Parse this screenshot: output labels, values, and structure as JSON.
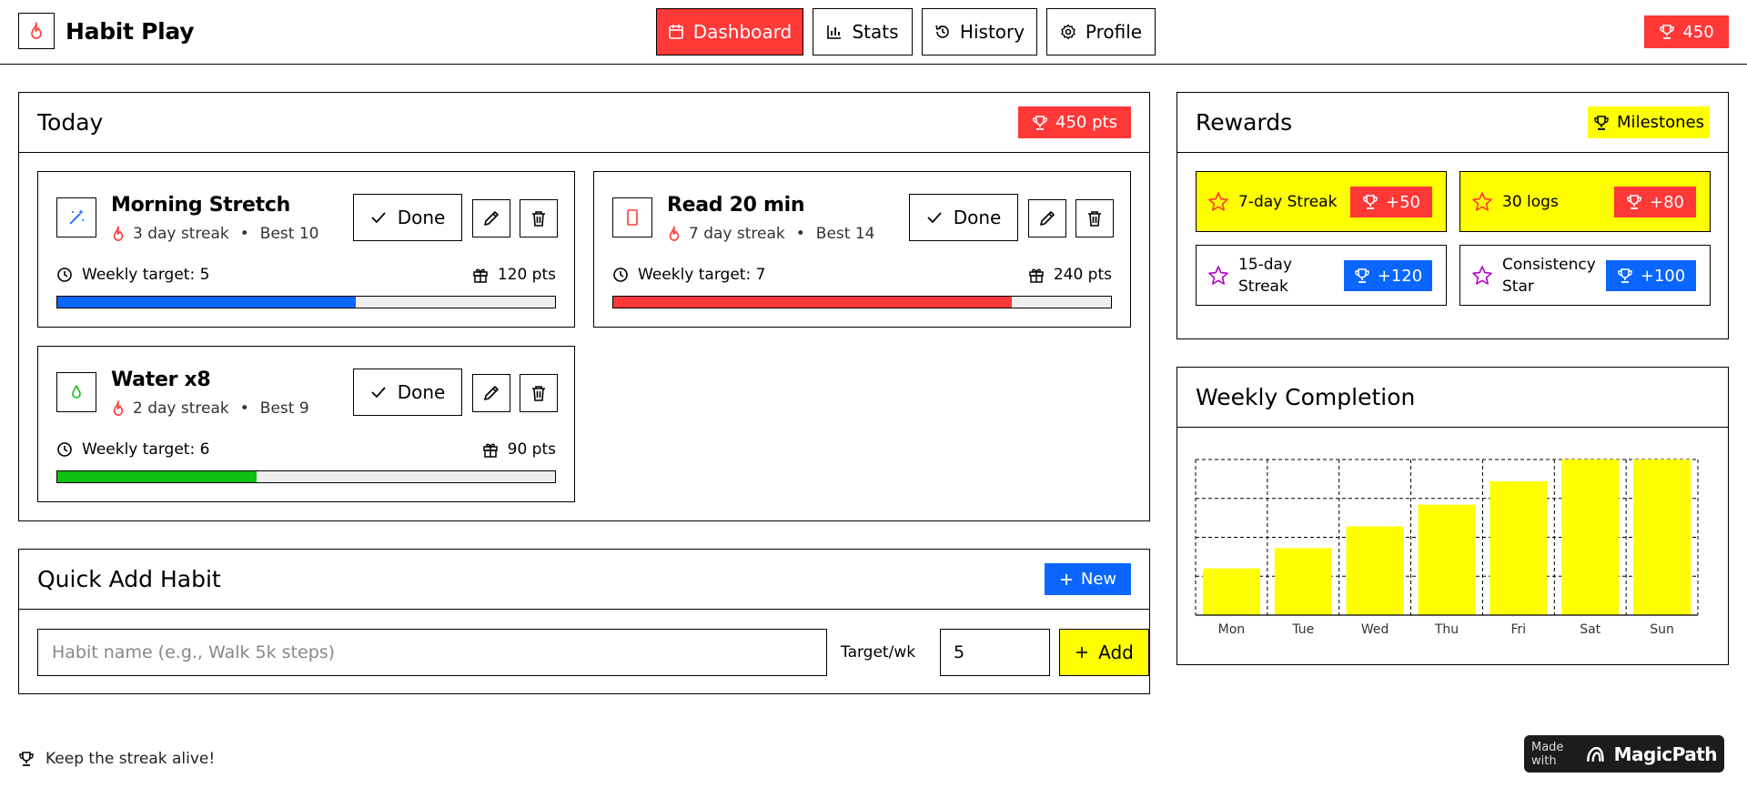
{
  "app": {
    "title": "Habit Play"
  },
  "nav": [
    {
      "label": "Dashboard",
      "icon": "calendar-icon",
      "active": true
    },
    {
      "label": "Stats",
      "icon": "bar-chart-icon",
      "active": false
    },
    {
      "label": "History",
      "icon": "history-icon",
      "active": false
    },
    {
      "label": "Profile",
      "icon": "gear-icon",
      "active": false
    }
  ],
  "header_points": "450",
  "colors": {
    "red": "#ff3838",
    "blue": "#0a66ff",
    "yellow": "#ffff00",
    "green": "#10c010",
    "purple": "#b000c8"
  },
  "today": {
    "title": "Today",
    "points_label": "450 pts",
    "habits": [
      {
        "name": "Morning Stretch",
        "icon": "magic-wand-icon",
        "streak": "3 day streak",
        "best": "Best 10",
        "done_label": "Done",
        "target": "Weekly target: 5",
        "points": "120 pts",
        "progress": 0.6,
        "color": "#0a66ff"
      },
      {
        "name": "Read 20 min",
        "icon": "book-icon",
        "streak": "7 day streak",
        "best": "Best 14",
        "done_label": "Done",
        "target": "Weekly target: 7",
        "points": "240 pts",
        "progress": 0.8,
        "color": "#ff3838"
      },
      {
        "name": "Water x8",
        "icon": "droplet-icon",
        "streak": "2 day streak",
        "best": "Best 9",
        "done_label": "Done",
        "target": "Weekly target: 6",
        "points": "90 pts",
        "progress": 0.4,
        "color": "#10c010"
      }
    ]
  },
  "rewards": {
    "title": "Rewards",
    "milestones_label": "Milestones",
    "items": [
      {
        "label": "7-day Streak",
        "points": "+50",
        "achieved": true
      },
      {
        "label": "30 logs",
        "points": "+80",
        "achieved": true
      },
      {
        "label": "15-day Streak",
        "points": "+120",
        "achieved": false
      },
      {
        "label": "Consistency Star",
        "points": "+100",
        "achieved": false
      }
    ]
  },
  "weekly": {
    "title": "Weekly Completion"
  },
  "chart_data": {
    "type": "bar",
    "categories": [
      "Mon",
      "Tue",
      "Wed",
      "Thu",
      "Fri",
      "Sat",
      "Sun"
    ],
    "values": [
      30,
      43,
      57,
      71,
      86,
      100,
      100
    ],
    "ylim": [
      0,
      100
    ],
    "grid": true,
    "color": "#ffff00"
  },
  "quick_add": {
    "title": "Quick Add Habit",
    "new_label": "New",
    "name_placeholder": "Habit name (e.g., Walk 5k steps)",
    "target_label": "Target/wk",
    "target_value": "5",
    "add_label": "Add"
  },
  "footer": {
    "text": "Keep the streak alive!"
  },
  "badge": {
    "made_with": "Made with",
    "brand": "MagicPath"
  }
}
